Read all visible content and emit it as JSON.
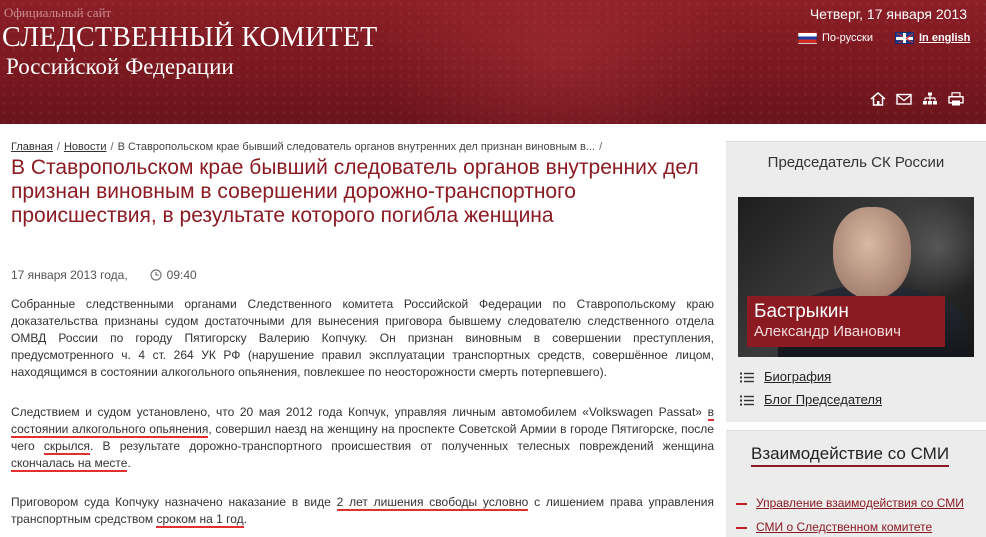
{
  "header": {
    "site_kind": "Официальный сайт",
    "title": "СЛЕДСТВЕННЫЙ КОМИТЕТ",
    "subtitle": "Российской Федерации",
    "date": "Четверг, 17 января 2013",
    "lang_ru": "По-русски",
    "lang_en": "In english",
    "tool_icons": [
      "home-icon",
      "mail-icon",
      "sitemap-icon",
      "print-icon"
    ]
  },
  "breadcrumb": {
    "home": "Главная",
    "news": "Новости",
    "current": "В Ставропольском крае бывший следователь органов внутренних дел признан виновным в...",
    "separator": "/"
  },
  "article": {
    "title": "В Ставропольском крае бывший следователь органов внутренних дел признан виновным в совершении дорожно-транспортного происшествия, в результате которого погибла женщина",
    "date": "17 января 2013 года,",
    "time": "09:40",
    "p1": "Собранные следственными органами Следственного комитета Российской Федерации по Ставропольскому краю доказательства признаны судом достаточными для вынесения приговора бывшему следователю следственного отдела ОМВД России по городу Пятигорску Валерию Копчуку. Он признан виновным в совершении преступления, предусмотренного ч. 4 ст. 264 УК РФ (нарушение правил эксплуатации транспортных средств, совершённое лицом, находящимся в состоянии алкогольного опьянения, повлекшее по неосторожности смерть потерпевшего).",
    "p2": {
      "a": "Следствием и судом установлено, что 20 мая 2012 года Копчук, управляя личным автомобилем «Volkswagen Passat»",
      "hl1": "в состоянии алкогольного опьянения",
      "b": ", совершил наезд на женщину на проспекте Советской Армии в городе Пятигорске, после чего",
      "hl2": "скрылся",
      "c": ". В результате дорожно-транспортного происшествия от полученных телесных повреждений женщина",
      "hl3": "скончалась на месте",
      "d": "."
    },
    "p3": {
      "a": "Приговором суда Копчуку назначено наказание в виде",
      "hl1": "2 лет лишения свободы условно",
      "b": "с лишением права управления транспортным средством",
      "hl2": "сроком на 1 год",
      "c": "."
    }
  },
  "sidebar": {
    "chairman_heading": "Председатель СК России",
    "chairman_last_name": "Бастрыкин",
    "chairman_first_name": "Александр Иванович",
    "links": [
      {
        "label": "Биография"
      },
      {
        "label": "Блог Председателя"
      }
    ],
    "media_heading": "Взаимодействие со СМИ",
    "media_links": [
      {
        "label": "Управление взаимодействия со СМИ"
      },
      {
        "label": "СМИ о Следственном комитете"
      }
    ]
  },
  "colors": {
    "brand": "#8b1a22",
    "highlight": "#e23030",
    "sidebar_bg": "#ececec"
  }
}
